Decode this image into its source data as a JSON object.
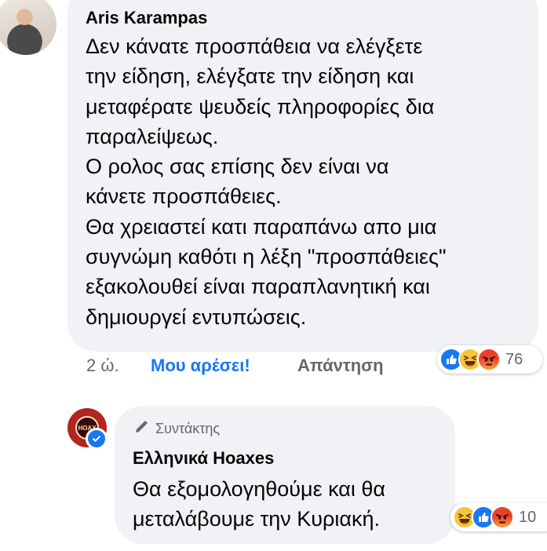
{
  "comment_1": {
    "author": "Aris Karampas",
    "text_lines": [
      "Δεν κάνατε προσπάθεια να ελέγξετε",
      "την είδηση, ελέγξατε την είδηση και",
      "μεταφέρατε ψευδείς πληροφορίες δια",
      "παραλείψεως.",
      "Ο ρολος σας επίσης δεν είναι να",
      "κάνετε προσπάθειες.",
      "Θα χρειαστεί κατι παραπάνω απο μια",
      "συγνώμη καθότι η λέξη \"προσπάθειες\"",
      "εξακολουθεί είναι παραπλανητική και",
      "δημιουργεί εντυπώσεις."
    ],
    "time": "2 ώ.",
    "like_label": "Μου αρέσει!",
    "reply_label": "Απάντηση",
    "reactions": [
      "like-icon",
      "haha-icon",
      "angry-icon"
    ],
    "reaction_count": "76"
  },
  "comment_2": {
    "role": "Συντάκτης",
    "author": "Ελληνικά Hoaxes",
    "avatar_text": "HOAX",
    "text_lines": [
      "Θα εξομολογηθούμε και θα",
      "μεταλάβουμε την Κυριακή."
    ],
    "reactions": [
      "haha-icon",
      "like-icon",
      "angry-icon"
    ],
    "reaction_count": "10"
  },
  "colors": {
    "bubble": "#f0f2f5",
    "link_blue": "#1877f2",
    "muted": "#65676b"
  }
}
